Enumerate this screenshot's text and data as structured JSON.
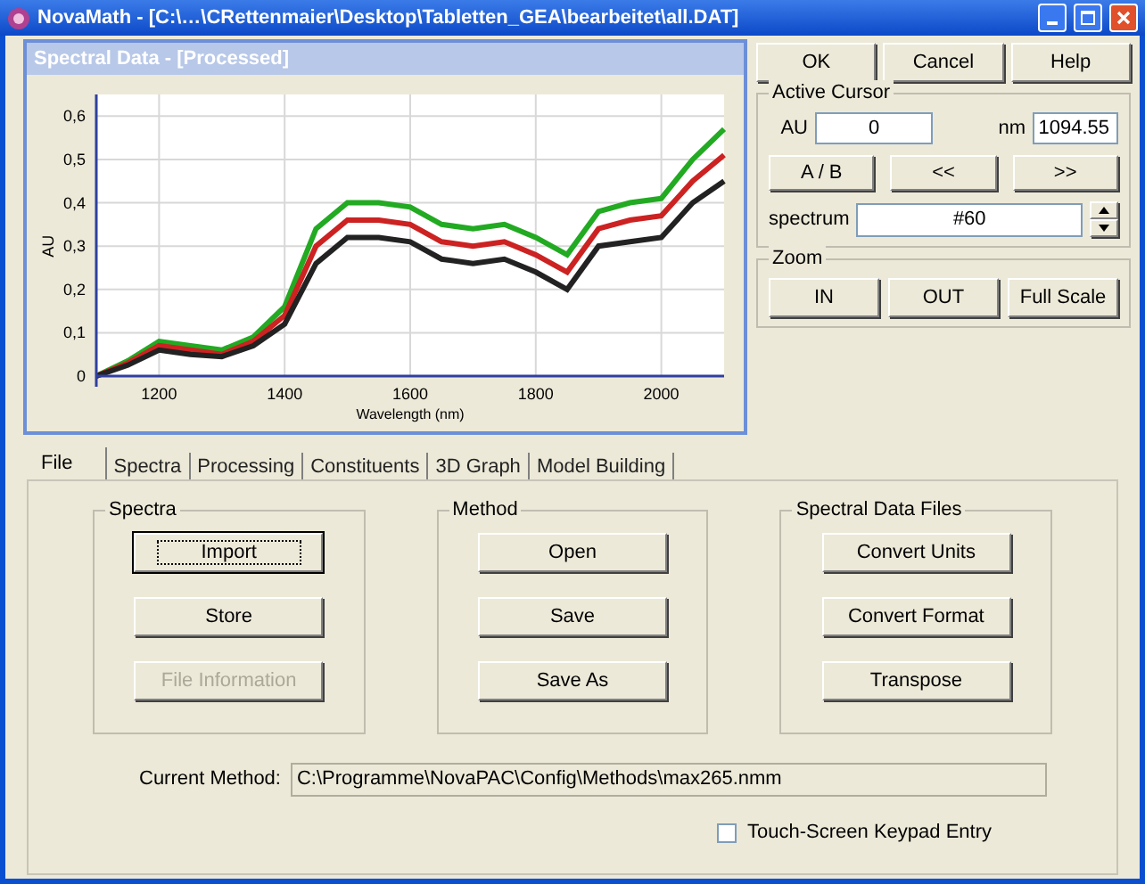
{
  "window": {
    "title": "NovaMath - [C:\\…\\CRettenmaier\\Desktop\\Tabletten_GEA\\bearbeitet\\all.DAT]"
  },
  "spectral_window": {
    "title": "Spectral Data - [Processed]",
    "chart_data": {
      "type": "line",
      "grid": true,
      "xlabel": "Wavelength (nm)",
      "ylabel": "AU",
      "x": [
        1100,
        1150,
        1200,
        1250,
        1300,
        1350,
        1400,
        1450,
        1500,
        1550,
        1600,
        1650,
        1700,
        1750,
        1800,
        1850,
        1900,
        1950,
        2000,
        2050,
        2100
      ],
      "series": [
        {
          "color": "#22aa22",
          "values": [
            0,
            0.035,
            0.08,
            0.07,
            0.06,
            0.09,
            0.16,
            0.34,
            0.4,
            0.4,
            0.39,
            0.35,
            0.34,
            0.35,
            0.32,
            0.28,
            0.38,
            0.4,
            0.41,
            0.5,
            0.57
          ]
        },
        {
          "color": "#cc2222",
          "values": [
            0,
            0.03,
            0.07,
            0.06,
            0.05,
            0.08,
            0.14,
            0.3,
            0.36,
            0.36,
            0.35,
            0.31,
            0.3,
            0.31,
            0.28,
            0.24,
            0.34,
            0.36,
            0.37,
            0.45,
            0.51
          ]
        },
        {
          "color": "#222222",
          "values": [
            0,
            0.025,
            0.06,
            0.05,
            0.045,
            0.07,
            0.12,
            0.26,
            0.32,
            0.32,
            0.31,
            0.27,
            0.26,
            0.27,
            0.24,
            0.2,
            0.3,
            0.31,
            0.32,
            0.4,
            0.45
          ]
        }
      ],
      "xlim": [
        1100,
        2100
      ],
      "ylim": [
        0,
        0.65
      ],
      "xticks": [
        1200,
        1400,
        1600,
        1800,
        2000
      ],
      "yticks": [
        {
          "value": 0,
          "label": "0"
        },
        {
          "value": 0.1,
          "label": "0,1"
        },
        {
          "value": 0.2,
          "label": "0,2"
        },
        {
          "value": 0.3,
          "label": "0,3"
        },
        {
          "value": 0.4,
          "label": "0,4"
        },
        {
          "value": 0.5,
          "label": "0,5"
        },
        {
          "value": 0.6,
          "label": "0,6"
        }
      ]
    }
  },
  "top_buttons": [
    "OK",
    "Cancel",
    "Help"
  ],
  "active_cursor": {
    "title": "Active Cursor",
    "au_label": "AU",
    "au_value": "0",
    "nm_label": "nm",
    "nm_value": "1094.55",
    "buttons": [
      "A / B",
      "<<",
      ">>"
    ],
    "spectrum_label": "spectrum",
    "spectrum_value": "#60"
  },
  "zoom": {
    "title": "Zoom",
    "buttons": [
      "IN",
      "OUT",
      "Full Scale"
    ]
  },
  "tabs": [
    {
      "label": "File",
      "selected": true
    },
    {
      "label": "Spectra",
      "selected": false
    },
    {
      "label": "Processing",
      "selected": false
    },
    {
      "label": "Constituents",
      "selected": false
    },
    {
      "label": "3D Graph",
      "selected": false
    },
    {
      "label": "Model Building",
      "selected": false
    }
  ],
  "groups": [
    {
      "title": "Spectra",
      "buttons": [
        {
          "label": "Import",
          "focused": true,
          "disabled": false
        },
        {
          "label": "Store",
          "focused": false,
          "disabled": false
        },
        {
          "label": "File Information",
          "focused": false,
          "disabled": true
        }
      ]
    },
    {
      "title": "Method",
      "buttons": [
        {
          "label": "Open",
          "focused": false,
          "disabled": false
        },
        {
          "label": "Save",
          "focused": false,
          "disabled": false
        },
        {
          "label": "Save As",
          "focused": false,
          "disabled": false
        }
      ]
    },
    {
      "title": "Spectral Data Files",
      "buttons": [
        {
          "label": "Convert Units",
          "focused": false,
          "disabled": false
        },
        {
          "label": "Convert Format",
          "focused": false,
          "disabled": false
        },
        {
          "label": "Transpose",
          "focused": false,
          "disabled": false
        }
      ]
    }
  ],
  "current_method": {
    "label": "Current Method:",
    "value": "C:\\Programme\\NovaPAC\\Config\\Methods\\max265.nmm"
  },
  "keypad_option": {
    "label": "Touch-Screen Keypad Entry",
    "checked": false
  }
}
